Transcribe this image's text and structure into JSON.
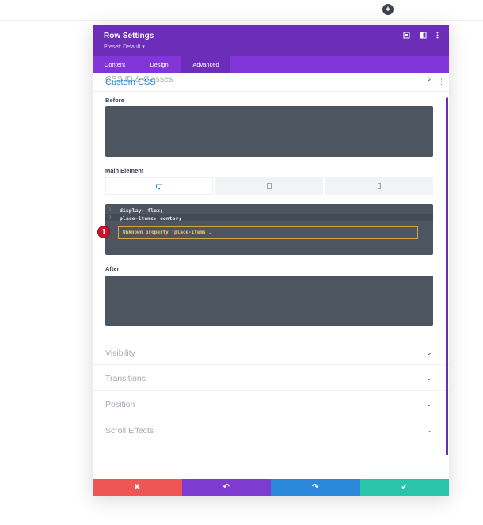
{
  "page": {
    "add_icon": "+"
  },
  "header": {
    "title": "Row Settings",
    "preset": "Preset: Default ▾",
    "icons": [
      "expand-icon",
      "split-view-icon",
      "more-icon"
    ],
    "accent": "#6c2eb9"
  },
  "tabs": [
    {
      "label": "Content"
    },
    {
      "label": "Design"
    },
    {
      "label": "Advanced",
      "active": true
    }
  ],
  "sections": {
    "css_id": "CSS ID & Classes",
    "custom_css": "Custom CSS",
    "visibility": "Visibility",
    "transitions": "Transitions",
    "position": "Position",
    "scroll_effects": "Scroll Effects"
  },
  "fields": {
    "before_label": "Before",
    "main_label": "Main Element",
    "after_label": "After"
  },
  "device_tabs": [
    {
      "icon": "desktop-icon",
      "active": true
    },
    {
      "icon": "tablet-icon",
      "active": false
    },
    {
      "icon": "phone-icon",
      "active": false
    }
  ],
  "editor": {
    "lines": [
      {
        "num": "1",
        "code": "display: flex;"
      },
      {
        "num": "2",
        "code": "place-items: center;"
      }
    ],
    "error": "Unknown property 'place-items'."
  },
  "badge": "1",
  "footer": {
    "cancel": "✖",
    "undo": "↶",
    "redo": "↷",
    "save": "✔",
    "colors": {
      "cancel": "#ef5555",
      "undo": "#7e3bd0",
      "redo": "#2b87da",
      "save": "#29c4a9"
    }
  }
}
